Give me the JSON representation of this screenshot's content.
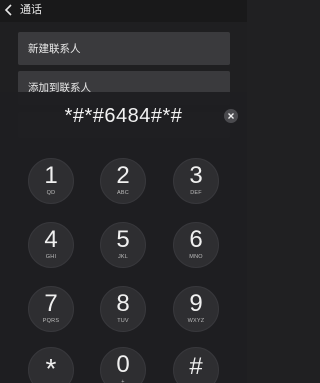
{
  "header": {
    "title": "通话",
    "back_icon": "chevron-left-icon"
  },
  "menu": {
    "items": [
      {
        "label": "新建联系人"
      },
      {
        "label": "添加到联系人"
      },
      {
        "label": ""
      }
    ]
  },
  "dialer": {
    "number": "*#*#6484#*#",
    "clear_icon": "close-icon",
    "keys": [
      {
        "digit": "1",
        "letters": "QD"
      },
      {
        "digit": "2",
        "letters": "ABC"
      },
      {
        "digit": "3",
        "letters": "DEF"
      },
      {
        "digit": "4",
        "letters": "GHI"
      },
      {
        "digit": "5",
        "letters": "JKL"
      },
      {
        "digit": "6",
        "letters": "MNO"
      },
      {
        "digit": "7",
        "letters": "PQRS"
      },
      {
        "digit": "8",
        "letters": "TUV"
      },
      {
        "digit": "9",
        "letters": "WXYZ"
      },
      {
        "digit": "*",
        "letters": ""
      },
      {
        "digit": "0",
        "letters": "+"
      },
      {
        "digit": "#",
        "letters": ""
      }
    ]
  },
  "colors": {
    "background": "#1f1f21",
    "card": "#3a3a3d",
    "text": "#f0f0f0"
  }
}
